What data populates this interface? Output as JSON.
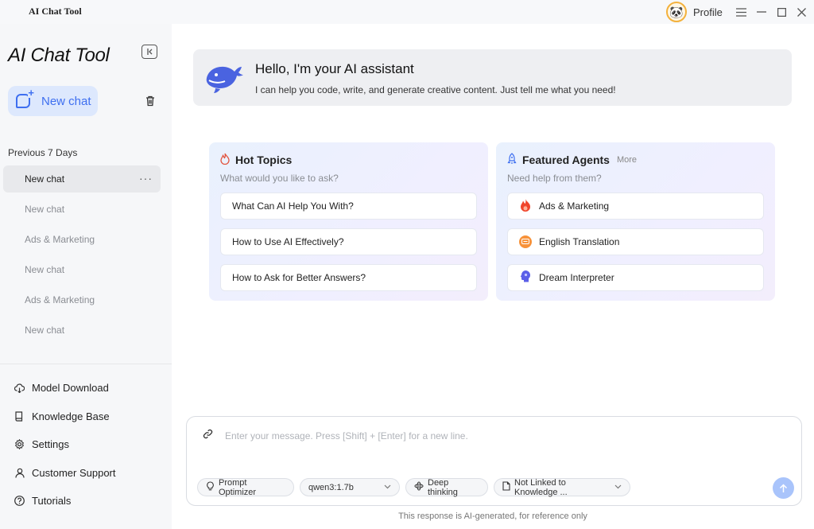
{
  "window": {
    "title": "AI Chat Tool",
    "profile_label": "Profile",
    "controls": [
      "menu",
      "minimize",
      "maximize",
      "close"
    ]
  },
  "sidebar": {
    "brand": "AI Chat Tool",
    "new_chat_label": "New chat",
    "section_title": "Previous 7 Days",
    "history": [
      {
        "label": "New chat",
        "active": true
      },
      {
        "label": "New chat",
        "active": false
      },
      {
        "label": "Ads & Marketing",
        "active": false
      },
      {
        "label": "New chat",
        "active": false
      },
      {
        "label": "Ads & Marketing",
        "active": false
      },
      {
        "label": "New chat",
        "active": false
      }
    ],
    "menu": [
      {
        "label": "Model Download",
        "icon": "cloud-download-icon"
      },
      {
        "label": "Knowledge Base",
        "icon": "book-icon"
      },
      {
        "label": "Settings",
        "icon": "gear-icon"
      },
      {
        "label": "Customer Support",
        "icon": "user-icon"
      },
      {
        "label": "Tutorials",
        "icon": "question-icon"
      }
    ]
  },
  "welcome": {
    "title": "Hello, I'm your AI assistant",
    "subtitle": "I can help you code, write, and generate creative content. Just tell me what you need!"
  },
  "hot_topics": {
    "title": "Hot Topics",
    "subtitle": "What would you like to ask?",
    "items": [
      "What Can AI Help You With?",
      "How to Use AI Effectively?",
      "How to Ask for Better Answers?"
    ]
  },
  "featured_agents": {
    "title": "Featured Agents",
    "more_label": "More",
    "subtitle": "Need help from them?",
    "items": [
      {
        "label": "Ads & Marketing",
        "icon": "flame-icon",
        "color": "#f0452b"
      },
      {
        "label": "English Translation",
        "icon": "translate-icon",
        "color": "#f7923a"
      },
      {
        "label": "Dream Interpreter",
        "icon": "head-icon",
        "color": "#5b5fe8"
      }
    ]
  },
  "composer": {
    "placeholder": "Enter your message. Press [Shift] + [Enter] for a new line.",
    "prompt_optimizer_label": "Prompt Optimizer",
    "model_value": "qwen3:1.7b",
    "deep_thinking_label": "Deep thinking",
    "knowledge_value": "Not Linked to Knowledge ..."
  },
  "disclaimer": "This response is AI-generated, for reference only",
  "colors": {
    "accent": "#3e6ff0",
    "send_button": "#a9c4fb",
    "sidebar_bg": "#f6f7f9"
  }
}
